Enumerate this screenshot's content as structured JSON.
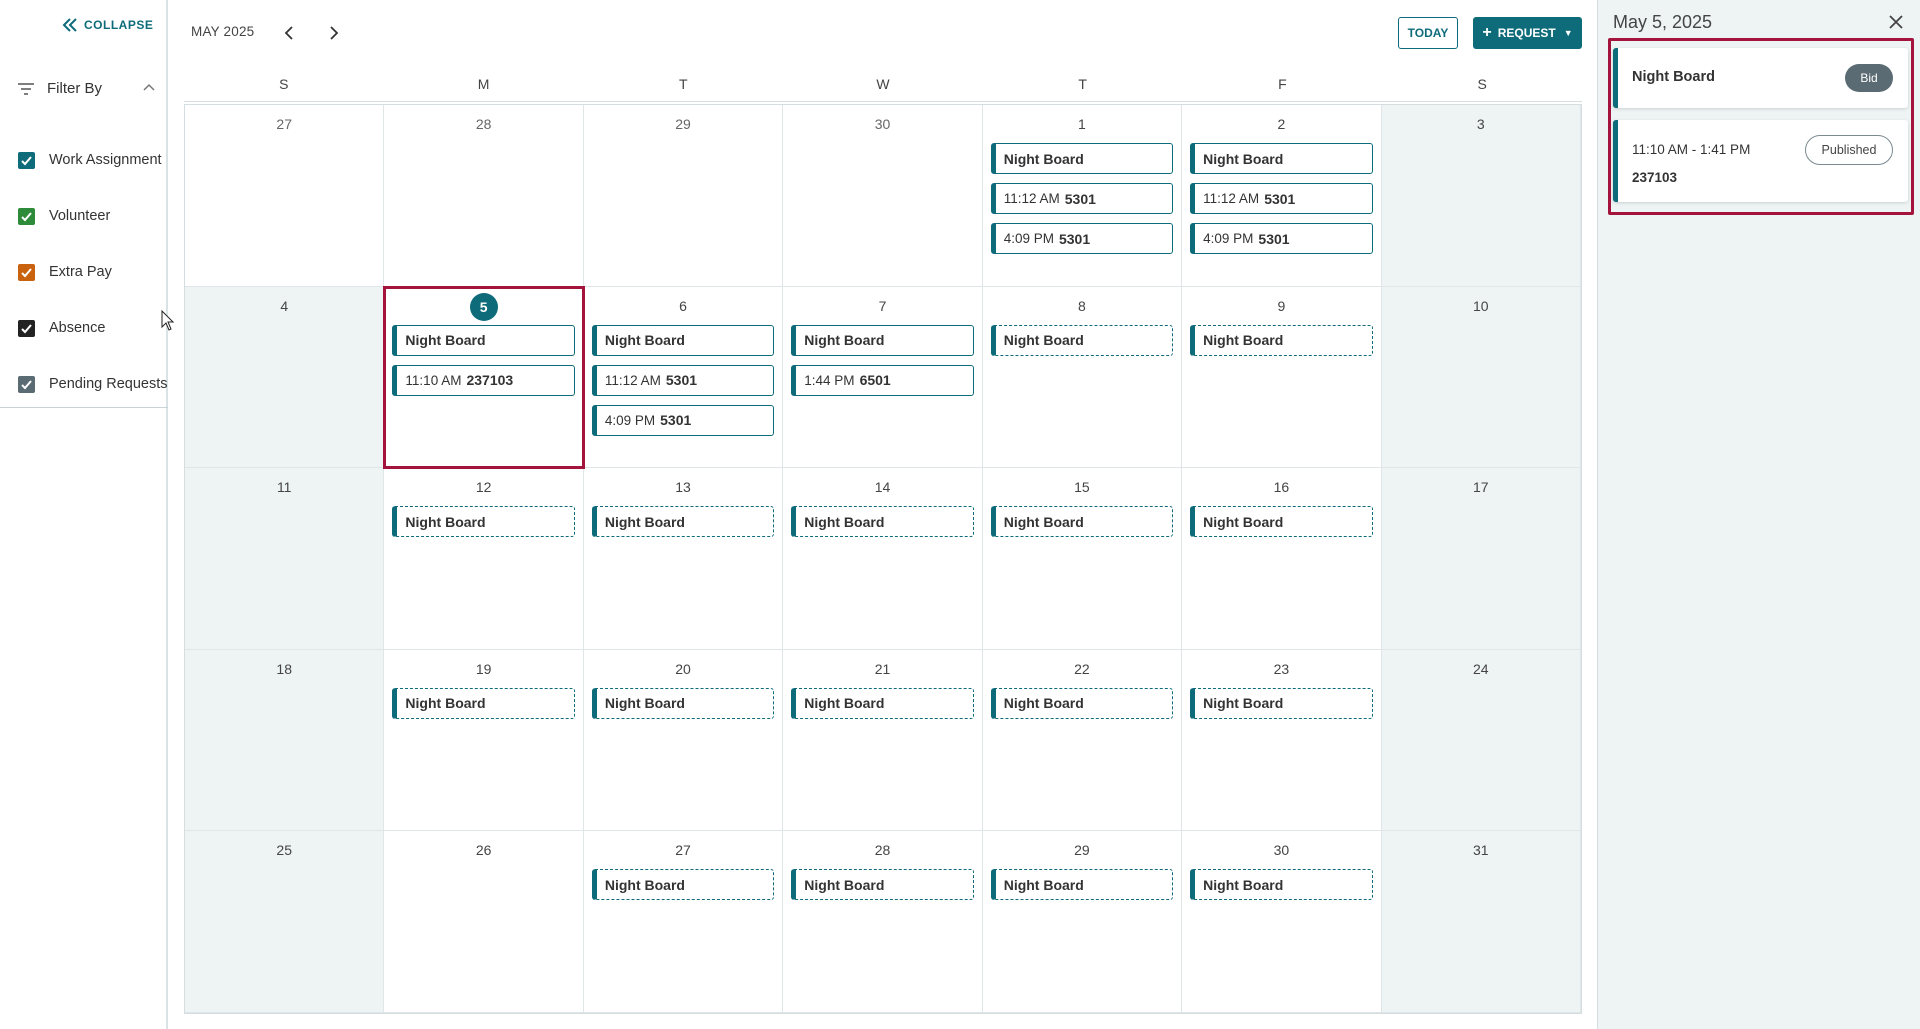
{
  "sidebar": {
    "collapse_label": "COLLAPSE",
    "filter_title": "Filter By",
    "filters": [
      {
        "label": "Work Assignment",
        "color": "#0e6b7a"
      },
      {
        "label": "Volunteer",
        "color": "#2e8b3a"
      },
      {
        "label": "Extra Pay",
        "color": "#c8620f"
      },
      {
        "label": "Absence",
        "color": "#222222"
      },
      {
        "label": "Pending Requests",
        "color": "#5a6b73"
      }
    ]
  },
  "header": {
    "month": "MAY 2025",
    "today_label": "TODAY",
    "request_label": "REQUEST"
  },
  "weekdays": [
    "S",
    "M",
    "T",
    "W",
    "T",
    "F",
    "S"
  ],
  "calendar": {
    "days": [
      {
        "num": "27",
        "other": true,
        "weekend": false,
        "events": []
      },
      {
        "num": "28",
        "other": true,
        "weekend": false,
        "events": []
      },
      {
        "num": "29",
        "other": true,
        "weekend": false,
        "events": []
      },
      {
        "num": "30",
        "other": true,
        "weekend": false,
        "events": []
      },
      {
        "num": "1",
        "weekend": false,
        "events": [
          {
            "title": "Night Board"
          },
          {
            "time": "11:12 AM",
            "code": "5301"
          },
          {
            "time": "4:09 PM",
            "code": "5301"
          }
        ]
      },
      {
        "num": "2",
        "weekend": false,
        "events": [
          {
            "title": "Night Board"
          },
          {
            "time": "11:12 AM",
            "code": "5301"
          },
          {
            "time": "4:09 PM",
            "code": "5301"
          }
        ]
      },
      {
        "num": "3",
        "weekend": true,
        "events": []
      },
      {
        "num": "4",
        "weekend": true,
        "events": []
      },
      {
        "num": "5",
        "weekend": false,
        "today": true,
        "selected": true,
        "events": [
          {
            "title": "Night Board"
          },
          {
            "time": "11:10 AM",
            "code": "237103"
          }
        ]
      },
      {
        "num": "6",
        "weekend": false,
        "events": [
          {
            "title": "Night Board"
          },
          {
            "time": "11:12 AM",
            "code": "5301"
          },
          {
            "time": "4:09 PM",
            "code": "5301"
          }
        ]
      },
      {
        "num": "7",
        "weekend": false,
        "events": [
          {
            "title": "Night Board"
          },
          {
            "time": "1:44 PM",
            "code": "6501"
          }
        ]
      },
      {
        "num": "8",
        "weekend": false,
        "events": [
          {
            "title": "Night Board",
            "dashed": true
          }
        ]
      },
      {
        "num": "9",
        "weekend": false,
        "events": [
          {
            "title": "Night Board",
            "dashed": true
          }
        ]
      },
      {
        "num": "10",
        "weekend": true,
        "events": []
      },
      {
        "num": "11",
        "weekend": true,
        "events": []
      },
      {
        "num": "12",
        "weekend": false,
        "events": [
          {
            "title": "Night Board",
            "dashed": true
          }
        ]
      },
      {
        "num": "13",
        "weekend": false,
        "events": [
          {
            "title": "Night Board",
            "dashed": true
          }
        ]
      },
      {
        "num": "14",
        "weekend": false,
        "events": [
          {
            "title": "Night Board",
            "dashed": true
          }
        ]
      },
      {
        "num": "15",
        "weekend": false,
        "events": [
          {
            "title": "Night Board",
            "dashed": true
          }
        ]
      },
      {
        "num": "16",
        "weekend": false,
        "events": [
          {
            "title": "Night Board",
            "dashed": true
          }
        ]
      },
      {
        "num": "17",
        "weekend": true,
        "events": []
      },
      {
        "num": "18",
        "weekend": true,
        "events": []
      },
      {
        "num": "19",
        "weekend": false,
        "events": [
          {
            "title": "Night Board",
            "dashed": true
          }
        ]
      },
      {
        "num": "20",
        "weekend": false,
        "events": [
          {
            "title": "Night Board",
            "dashed": true
          }
        ]
      },
      {
        "num": "21",
        "weekend": false,
        "events": [
          {
            "title": "Night Board",
            "dashed": true
          }
        ]
      },
      {
        "num": "22",
        "weekend": false,
        "events": [
          {
            "title": "Night Board",
            "dashed": true
          }
        ]
      },
      {
        "num": "23",
        "weekend": false,
        "events": [
          {
            "title": "Night Board",
            "dashed": true
          }
        ]
      },
      {
        "num": "24",
        "weekend": true,
        "events": []
      },
      {
        "num": "25",
        "weekend": true,
        "events": []
      },
      {
        "num": "26",
        "weekend": false,
        "events": []
      },
      {
        "num": "27",
        "weekend": false,
        "events": [
          {
            "title": "Night Board",
            "dashed": true
          }
        ]
      },
      {
        "num": "28",
        "weekend": false,
        "events": [
          {
            "title": "Night Board",
            "dashed": true
          }
        ]
      },
      {
        "num": "29",
        "weekend": false,
        "events": [
          {
            "title": "Night Board",
            "dashed": true
          }
        ]
      },
      {
        "num": "30",
        "weekend": false,
        "events": [
          {
            "title": "Night Board",
            "dashed": true
          }
        ]
      },
      {
        "num": "31",
        "weekend": true,
        "events": []
      }
    ]
  },
  "panel": {
    "date": "May 5, 2025",
    "card1": {
      "title": "Night Board",
      "badge": "Bid"
    },
    "card2": {
      "time": "11:10 AM - 1:41 PM",
      "number": "237103",
      "badge": "Published"
    }
  },
  "colors": {
    "accent": "#0e6b7a",
    "highlight": "#a3133c",
    "weekend_bg": "#eef4f4"
  }
}
